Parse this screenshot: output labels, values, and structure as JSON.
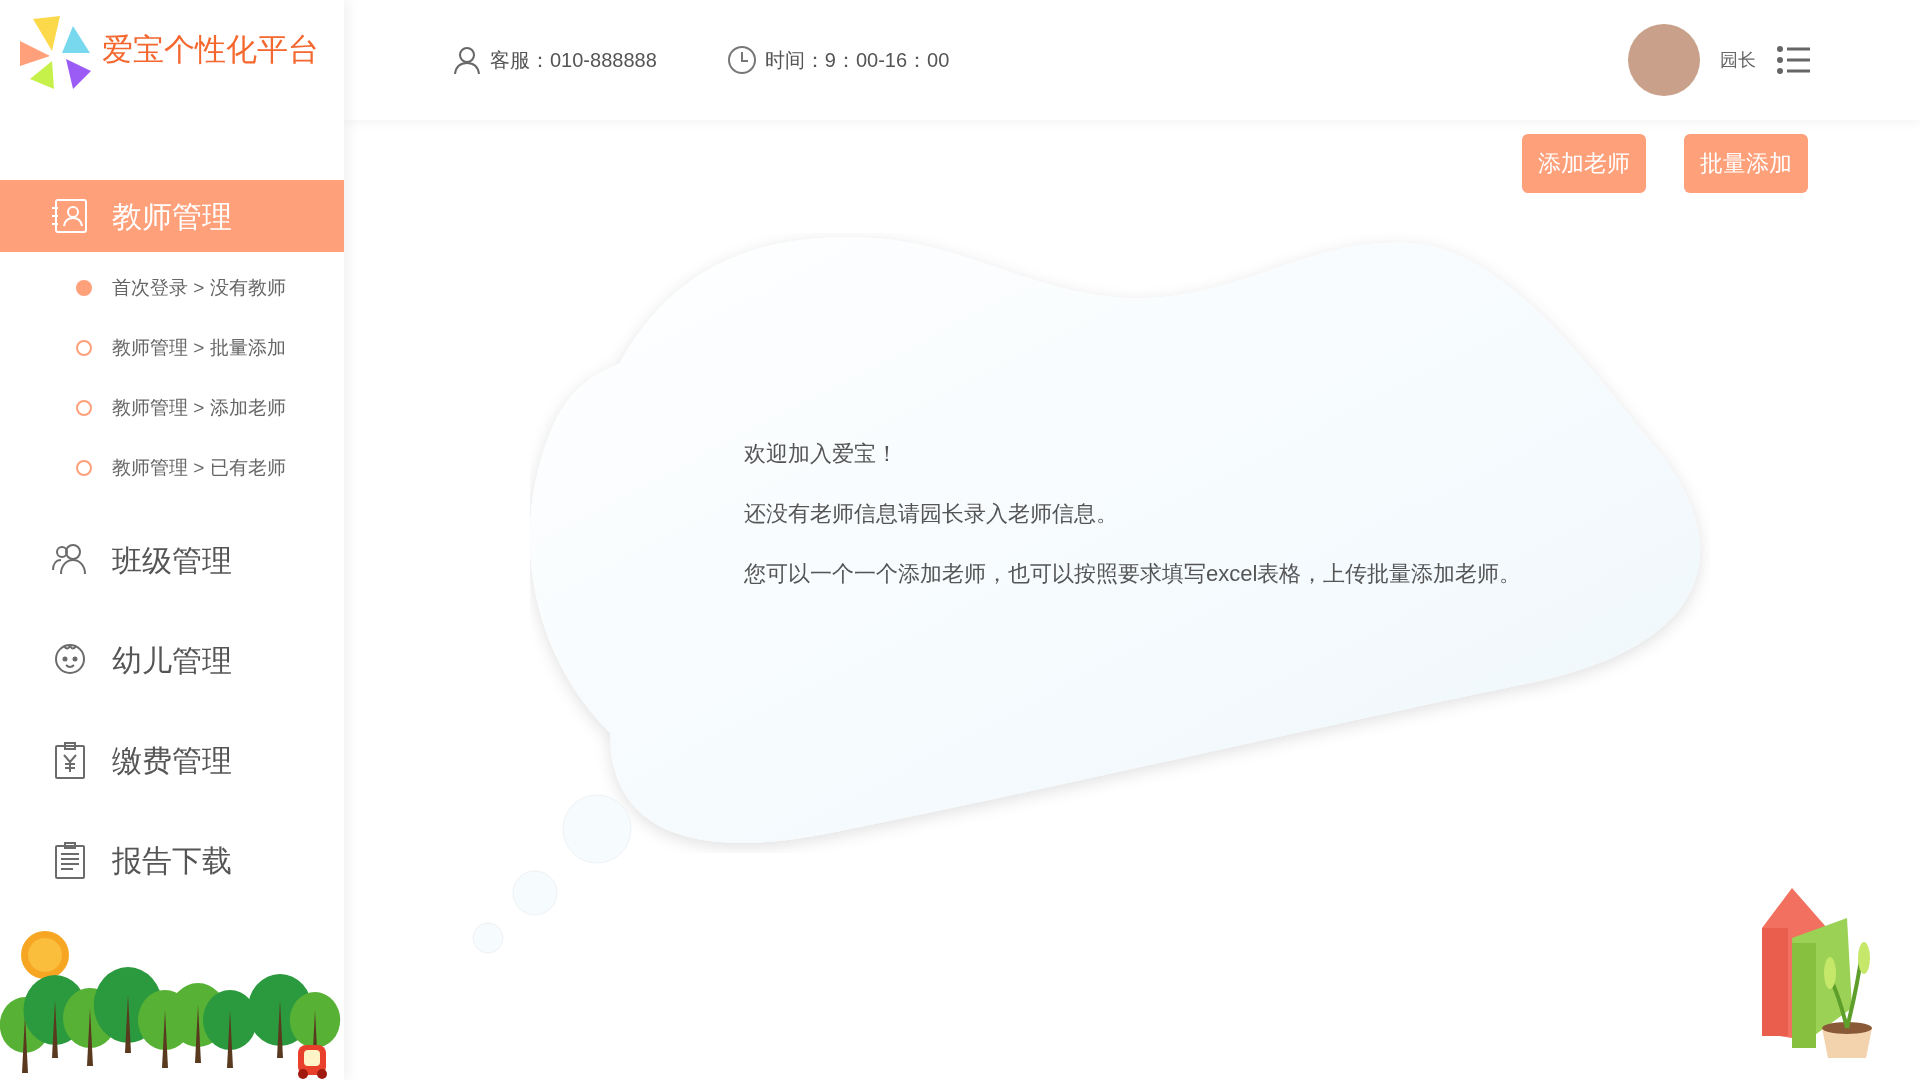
{
  "logo": {
    "title": "爱宝个性化平台"
  },
  "header": {
    "service": "客服：010-888888",
    "hours": "时间：9：00-16：00",
    "user": {
      "role": "园长"
    }
  },
  "actions": [
    {
      "label": "添加老师"
    },
    {
      "label": "批量添加"
    }
  ],
  "sidebar": {
    "items": [
      {
        "label": "教师管理",
        "selected": true,
        "children": [
          {
            "label": "首次登录 > 没有教师",
            "selected": true
          },
          {
            "label": "教师管理 > 批量添加",
            "selected": false
          },
          {
            "label": "教师管理 > 添加老师",
            "selected": false
          },
          {
            "label": "教师管理 > 已有老师",
            "selected": false
          }
        ]
      },
      {
        "label": "班级管理",
        "selected": false
      },
      {
        "label": "幼儿管理",
        "selected": false
      },
      {
        "label": "缴费管理",
        "selected": false
      },
      {
        "label": "报告下载",
        "selected": false
      }
    ]
  },
  "message": {
    "lines": [
      "欢迎加入爱宝！",
      "还没有老师信息请园长录入老师信息。",
      "您可以一个一个添加老师，也可以按照要求填写excel表格，上传批量添加老师。"
    ]
  }
}
